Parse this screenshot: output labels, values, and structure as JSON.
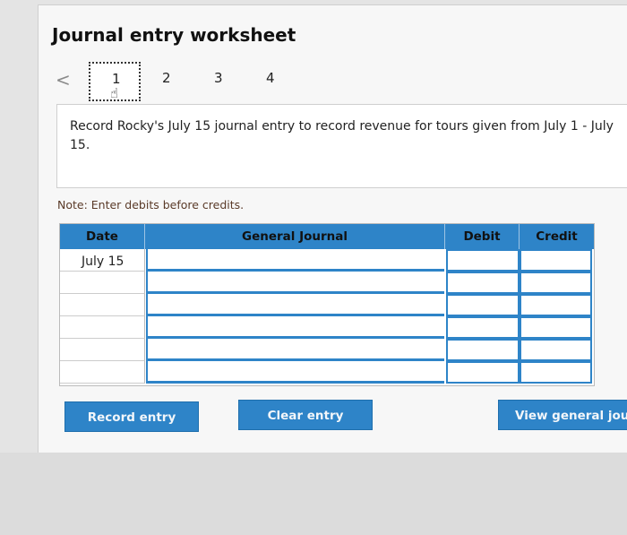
{
  "worksheet": {
    "title": "Journal entry worksheet",
    "prev_glyph": "<",
    "pages": [
      "1",
      "2",
      "3",
      "4"
    ],
    "active_page": "1"
  },
  "instruction": "Record Rocky's July 15 journal entry to record revenue for tours given from July 1 - July 15.",
  "note": "Note: Enter debits before credits.",
  "table": {
    "headers": {
      "date": "Date",
      "general_journal": "General Journal",
      "debit": "Debit",
      "credit": "Credit"
    },
    "rows": [
      {
        "date": "July 15",
        "account": "",
        "debit": "",
        "credit": ""
      },
      {
        "date": "",
        "account": "",
        "debit": "",
        "credit": ""
      },
      {
        "date": "",
        "account": "",
        "debit": "",
        "credit": ""
      },
      {
        "date": "",
        "account": "",
        "debit": "",
        "credit": ""
      },
      {
        "date": "",
        "account": "",
        "debit": "",
        "credit": ""
      },
      {
        "date": "",
        "account": "",
        "debit": "",
        "credit": ""
      }
    ]
  },
  "buttons": {
    "record": "Record entry",
    "clear": "Clear entry",
    "view": "View general journa"
  },
  "colors": {
    "accent": "#2e84c8"
  },
  "icons": {
    "prev": "chevron-left-icon",
    "cursor": "hand-pointer-icon"
  }
}
